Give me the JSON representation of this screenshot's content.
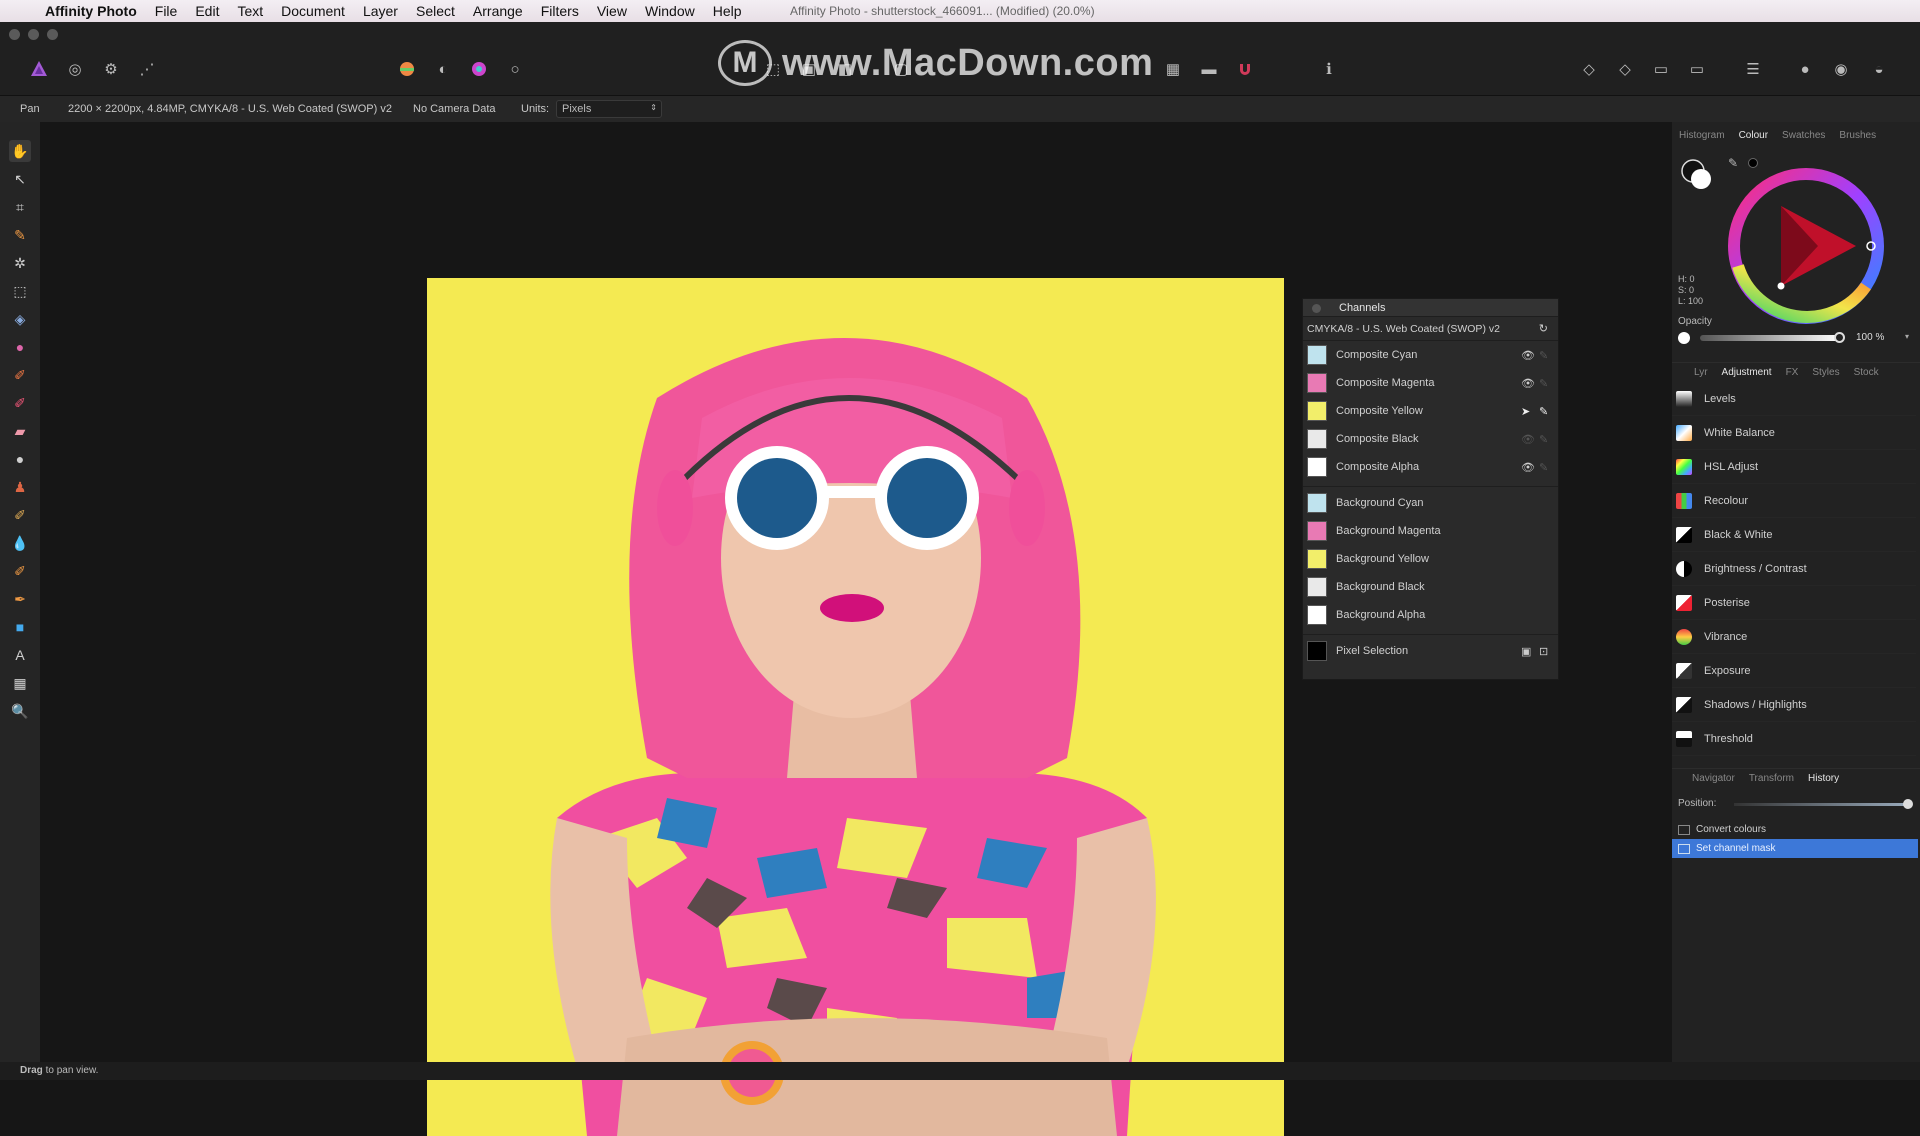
{
  "menubar": {
    "app_name": "Affinity Photo",
    "items": [
      "File",
      "Edit",
      "Text",
      "Document",
      "Layer",
      "Select",
      "Arrange",
      "Filters",
      "View",
      "Window",
      "Help"
    ],
    "window_title": "Affinity Photo - shutterstock_466091... (Modified) (20.0%)"
  },
  "watermark": {
    "text": "www.MacDown.com",
    "logo": "M"
  },
  "context_bar": {
    "tool": "Pan",
    "document_info": "2200 × 2200px, 4.84MP, CMYKA/8 - U.S. Web Coated (SWOP) v2",
    "camera": "No Camera Data",
    "units_label": "Units:",
    "units_value": "Pixels"
  },
  "channels": {
    "title": "Channels",
    "profile": "CMYKA/8 - U.S. Web Coated (SWOP) v2",
    "composite": [
      {
        "label": "Composite Cyan",
        "swatch": "#bfe3ee"
      },
      {
        "label": "Composite Magenta",
        "swatch": "#e87ab4"
      },
      {
        "label": "Composite Yellow",
        "swatch": "#f2ee6a"
      },
      {
        "label": "Composite Black",
        "swatch": "#e9e9e9"
      },
      {
        "label": "Composite Alpha",
        "swatch": "#ffffff"
      }
    ],
    "background": [
      {
        "label": "Background Cyan",
        "swatch": "#bfe3ee"
      },
      {
        "label": "Background Magenta",
        "swatch": "#e87ab4"
      },
      {
        "label": "Background Yellow",
        "swatch": "#f2ee6a"
      },
      {
        "label": "Background Black",
        "swatch": "#e9e9e9"
      },
      {
        "label": "Background Alpha",
        "swatch": "#ffffff"
      }
    ],
    "pixel_selection": "Pixel Selection"
  },
  "color_panel": {
    "tabs": [
      "Histogram",
      "Colour",
      "Swatches",
      "Brushes"
    ],
    "active_tab": "Colour",
    "h_label": "H: 0",
    "s_label": "S: 0",
    "l_label": "L: 100",
    "opacity_label": "Opacity",
    "opacity_value": "100 %",
    "opacity_percent": 100
  },
  "adjustment_panel": {
    "tabs": [
      "Lyr",
      "Adjustment",
      "FX",
      "Styles",
      "Stock"
    ],
    "active_tab": "Adjustment",
    "items": [
      {
        "label": "Levels",
        "icon": "levels-icon"
      },
      {
        "label": "White Balance",
        "icon": "white-balance-icon"
      },
      {
        "label": "HSL Adjust",
        "icon": "hsl-icon"
      },
      {
        "label": "Recolour",
        "icon": "recolour-icon"
      },
      {
        "label": "Black & White",
        "icon": "black-white-icon"
      },
      {
        "label": "Brightness / Contrast",
        "icon": "brightness-contrast-icon"
      },
      {
        "label": "Posterise",
        "icon": "posterise-icon"
      },
      {
        "label": "Vibrance",
        "icon": "vibrance-icon"
      },
      {
        "label": "Exposure",
        "icon": "exposure-icon"
      },
      {
        "label": "Shadows / Highlights",
        "icon": "shadows-highlights-icon"
      },
      {
        "label": "Threshold",
        "icon": "threshold-icon"
      }
    ]
  },
  "history_panel": {
    "tabs": [
      "Navigator",
      "Transform",
      "History"
    ],
    "active_tab": "History",
    "position_label": "Position:",
    "position_fraction": 1.0,
    "entries": [
      "Convert colours",
      "Set channel mask"
    ],
    "selected_index": 1
  },
  "status": {
    "bold": "Drag",
    "text": "to pan view."
  },
  "colors": {
    "accent": "#3d78d8",
    "canvas_bg": "#f4ea52",
    "hair": "#f0569a"
  }
}
